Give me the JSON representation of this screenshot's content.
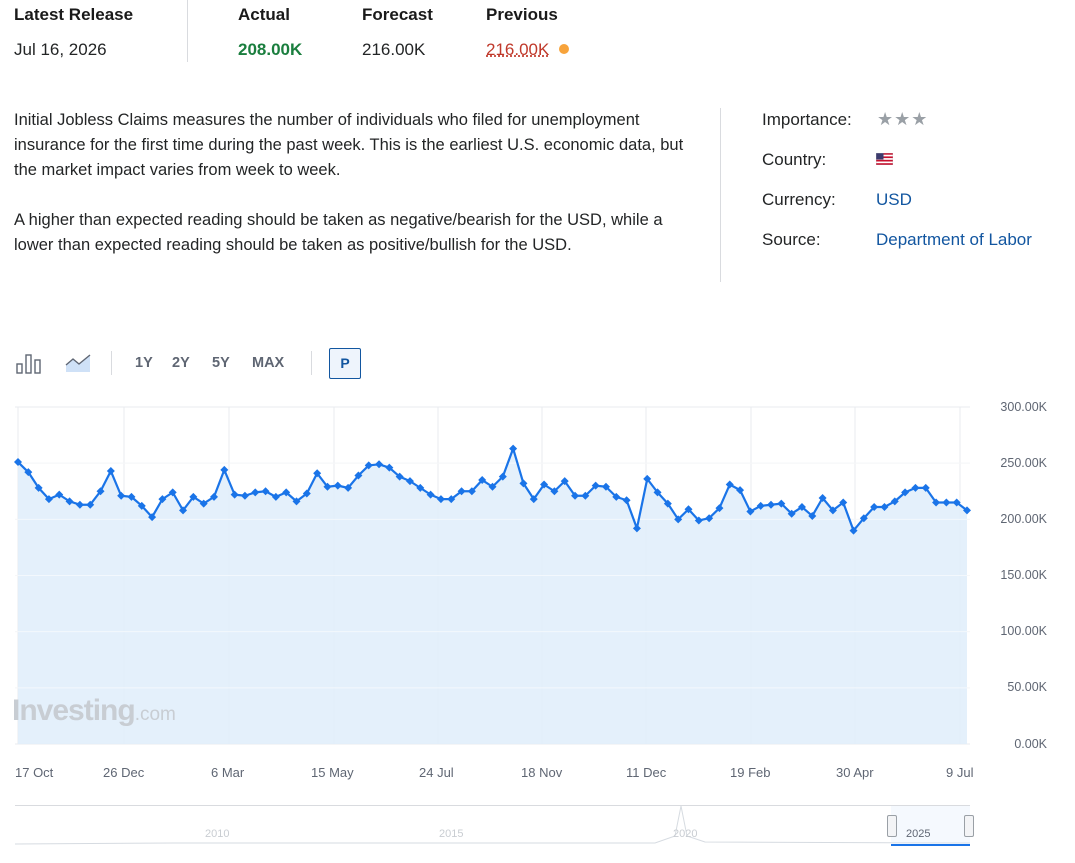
{
  "release": {
    "headers": {
      "latest": "Latest Release",
      "actual": "Actual",
      "forecast": "Forecast",
      "previous": "Previous"
    },
    "date": "Jul 16, 2026",
    "actual": "208.00K",
    "forecast": "216.00K",
    "previous": "216.00K",
    "colors": {
      "actual": "#1a7e3e",
      "previous": "#c0392b",
      "revised_dot": "#f7a33b"
    }
  },
  "description": {
    "para1": "Initial Jobless Claims measures the number of individuals who filed for unemployment insurance for the first time during the past week. This is the earliest U.S. economic data, but the market impact varies from week to week.",
    "para2": "A higher than expected reading should be taken as negative/bearish for the USD, while a lower than expected reading should be taken as positive/bullish for the USD."
  },
  "meta": {
    "importance_label": "Importance:",
    "importance_stars": 3,
    "importance_icon": "star-icon",
    "country_label": "Country:",
    "country_icon": "us-flag-icon",
    "currency_label": "Currency:",
    "currency_value": "USD",
    "source_label": "Source:",
    "source_value": "Department of Labor"
  },
  "toolbar": {
    "bar_chart_icon": "bar-chart-icon",
    "area_chart_icon": "area-chart-icon",
    "ranges": [
      "1Y",
      "2Y",
      "5Y",
      "MAX"
    ],
    "active_button": "P"
  },
  "watermark": {
    "brand": "Investing",
    "suffix": ".com"
  },
  "navigator": {
    "years": [
      "2010",
      "2015",
      "2020",
      "2025"
    ]
  },
  "chart_data": {
    "type": "area",
    "y_ticks": [
      "300.00K",
      "250.00K",
      "200.00K",
      "150.00K",
      "100.00K",
      "50.00K",
      "0.00K"
    ],
    "ylim": [
      0,
      300
    ],
    "y_unit": "K",
    "x_ticks": [
      "17 Oct",
      "26 Dec",
      "6 Mar",
      "15 May",
      "24 Jul",
      "18 Nov",
      "11 Dec",
      "19 Feb",
      "30 Apr",
      "9 Jul"
    ],
    "grid": true,
    "colors": {
      "line": "#1a74e8",
      "fill": "#e1eefb",
      "grid": "#e9ebef"
    },
    "values": [
      251,
      242,
      228,
      218,
      222,
      216,
      213,
      213,
      225,
      243,
      221,
      220,
      212,
      202,
      218,
      224,
      208,
      220,
      214,
      220,
      244,
      222,
      221,
      224,
      225,
      220,
      224,
      216,
      223,
      241,
      229,
      230,
      228,
      239,
      248,
      249,
      246,
      238,
      234,
      228,
      222,
      218,
      218,
      225,
      225,
      235,
      229,
      238,
      263,
      232,
      218,
      231,
      225,
      234,
      221,
      221,
      230,
      229,
      220,
      217,
      192,
      236,
      224,
      214,
      200,
      209,
      199,
      201,
      210,
      231,
      226,
      207,
      212,
      213,
      214,
      205,
      211,
      203,
      219,
      208,
      215,
      190,
      201,
      211,
      211,
      216,
      224,
      228,
      228,
      215,
      215,
      215,
      208
    ]
  }
}
